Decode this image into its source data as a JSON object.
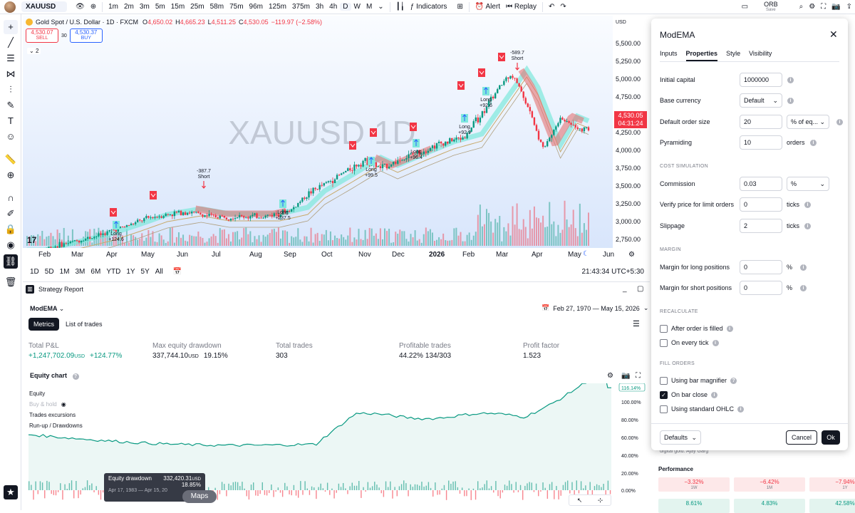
{
  "topbar": {
    "symbol": "XAUUSD",
    "intervals": [
      "1m",
      "2m",
      "3m",
      "5m",
      "15m",
      "25m",
      "58m",
      "75m",
      "96m",
      "125m",
      "375m",
      "3h",
      "4h",
      "D",
      "W",
      "M"
    ],
    "active_interval": "D",
    "indicators_label": "Indicators",
    "alert_label": "Alert",
    "replay_label": "Replay",
    "layout_name": "ORB",
    "layout_status": "Save"
  },
  "chart": {
    "title": "Gold Spot / U.S. Dollar · 1D · FXCM",
    "ohlc": {
      "o_label": "O",
      "o": "4,650.02",
      "h_label": "H",
      "h": "4,665.23",
      "l_label": "L",
      "l": "4,511.25",
      "c_label": "C",
      "c": "4,530.05",
      "chg": "−119.97 (−2.58%)"
    },
    "sell_price": "4,530.07",
    "sell_label": "SELL",
    "spread": "30",
    "buy_price": "4,530.37",
    "buy_label": "BUY",
    "indicator_count": "2",
    "watermark": "XAUUSD 1D",
    "currency": "USD",
    "price_levels": [
      "5,500.00",
      "5,250.00",
      "5,000.00",
      "4,750.00",
      "4,250.00",
      "4,000.00",
      "3,750.00",
      "3,500.00",
      "3,250.00",
      "3,000.00",
      "2,750.00"
    ],
    "last_price": "4,530.05",
    "countdown": "04:31:24",
    "time_labels": [
      "Feb",
      "Mar",
      "Apr",
      "May",
      "Jun",
      "Jul",
      "Aug",
      "Sep",
      "Oct",
      "Nov",
      "Dec",
      "2026",
      "Feb",
      "Mar",
      "Apr",
      "May",
      "Jun"
    ],
    "trade_labels": [
      {
        "side": "Long",
        "pnl": "+124.6"
      },
      {
        "side": "Short",
        "pnl": "-387.7"
      },
      {
        "side": "Long",
        "pnl": "+237.5"
      },
      {
        "side": "Long",
        "pnl": "+99.5"
      },
      {
        "side": "Long",
        "pnl": "+96.4"
      },
      {
        "side": "Long",
        "pnl": "+92.9"
      },
      {
        "side": "Long",
        "pnl": "+92.6"
      },
      {
        "side": "Short",
        "pnl": "-589.7"
      }
    ],
    "tv_logo": "17",
    "colors": {
      "bull": "#089981",
      "bear": "#f23645",
      "last_price_bg": "#f23645",
      "band_up": "#7ee8dc",
      "band_down": "#e57373"
    }
  },
  "timeframes": {
    "ranges": [
      "1D",
      "5D",
      "1M",
      "3M",
      "6M",
      "YTD",
      "1Y",
      "5Y",
      "All"
    ],
    "clock": "21:43:34 UTC+5:30"
  },
  "report": {
    "panel_title": "Strategy Report",
    "strategy_name": "ModEMA",
    "tabs": [
      "Metrics",
      "List of trades"
    ],
    "date_range": "Feb 27, 1970 — May 15, 2026",
    "metrics": [
      {
        "label": "Total P&L",
        "value": "+1,247,702.09",
        "unit": "USD",
        "extra": "+124.77%"
      },
      {
        "label": "Max equity drawdown",
        "value": "337,744.10",
        "unit": "USD",
        "extra": "19.15%"
      },
      {
        "label": "Total trades",
        "value": "303",
        "unit": "",
        "extra": ""
      },
      {
        "label": "Profitable trades",
        "value": "44.22%",
        "unit": "",
        "extra": "134/303"
      },
      {
        "label": "Profit factor",
        "value": "1.523",
        "unit": "",
        "extra": ""
      }
    ],
    "equity_title": "Equity chart",
    "legend": [
      "Equity",
      "Buy & hold",
      "Trades excursions",
      "Run-up / Drawdowns"
    ],
    "pct_axis": [
      "116.14%",
      "100.00%",
      "80.00%",
      "60.00%",
      "40.00%",
      "20.00%",
      "0.00%"
    ],
    "tooltip": {
      "title": "Equity drawdown",
      "value": "332,420.31",
      "unit": "USD",
      "pct": "18.85%",
      "range": "Apr 17, 1983 — Apr 15, 20"
    },
    "maps_label": "Maps"
  },
  "dialog": {
    "title": "ModEMA",
    "tabs": [
      "Inputs",
      "Properties",
      "Style",
      "Visibility"
    ],
    "active_tab": "Properties",
    "initial_capital_label": "Initial capital",
    "initial_capital": "1000000",
    "base_currency_label": "Base currency",
    "base_currency": "Default",
    "order_size_label": "Default order size",
    "order_size": "20",
    "order_size_unit": "% of eq...",
    "pyramiding_label": "Pyramiding",
    "pyramiding": "10",
    "pyramiding_unit": "orders",
    "cost_section": "COST SIMULATION",
    "commission_label": "Commission",
    "commission": "0.03",
    "commission_unit": "%",
    "verify_label": "Verify price for limit orders",
    "verify": "0",
    "verify_unit": "ticks",
    "slippage_label": "Slippage",
    "slippage": "2",
    "slippage_unit": "ticks",
    "margin_section": "MARGIN",
    "margin_long_label": "Margin for long positions",
    "margin_long": "0",
    "margin_long_unit": "%",
    "margin_short_label": "Margin for short positions",
    "margin_short": "0",
    "margin_short_unit": "%",
    "recalc_section": "RECALCULATE",
    "after_fill_label": "After order is filled",
    "every_tick_label": "On every tick",
    "fill_section": "FILL ORDERS",
    "magnifier_label": "Using bar magnifier",
    "bar_close_label": "On bar close",
    "ohlc_label": "Using standard OHLC",
    "defaults_label": "Defaults",
    "cancel_label": "Cancel",
    "ok_label": "Ok"
  },
  "behind": {
    "caption": "digital gold. Ajay Garg",
    "perf_title": "Performance",
    "perf": [
      {
        "value": "−3.32%",
        "period": "1W"
      },
      {
        "value": "−6.42%",
        "period": "1M"
      },
      {
        "value": "−7.94%",
        "period": "1Y"
      },
      {
        "value": "8.61%",
        "period": ""
      },
      {
        "value": "4.83%",
        "period": ""
      },
      {
        "value": "42.58%",
        "period": ""
      }
    ]
  }
}
